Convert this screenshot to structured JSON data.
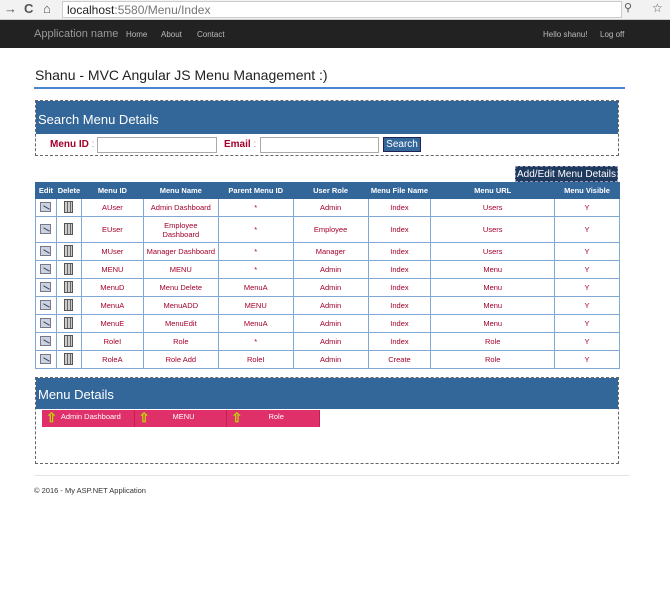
{
  "browser": {
    "url_host": "localhost",
    "url_path": ":5580/Menu/Index"
  },
  "navbar": {
    "brand": "Application name",
    "links": [
      "Home",
      "About",
      "Contact"
    ],
    "greeting": "Hello shanu!",
    "logoff": "Log off"
  },
  "page_title": "Shanu - MVC Angular JS Menu Management :)",
  "search": {
    "title": "Search Menu Details",
    "menu_id_label": "Menu ID",
    "email_label": "Email",
    "colon": ":",
    "menu_id_value": "",
    "email_value": "",
    "button": "Search"
  },
  "add_edit_button": "Add/Edit Menu Details",
  "table": {
    "headers": [
      "Edit",
      "Delete",
      "Menu ID",
      "Menu Name",
      "Parent Menu ID",
      "User Role",
      "Menu File Name",
      "Menu URL",
      "Menu Visible"
    ],
    "rows": [
      [
        "AUser",
        "Admin Dashboard",
        "*",
        "Admin",
        "Index",
        "Users",
        "Y"
      ],
      [
        "EUser",
        "Employee Dashboard",
        "*",
        "Employee",
        "Index",
        "Users",
        "Y"
      ],
      [
        "MUser",
        "Manager Dashboard",
        "*",
        "Manager",
        "Index",
        "Users",
        "Y"
      ],
      [
        "MENU",
        "MENU",
        "*",
        "Admin",
        "Index",
        "Menu",
        "Y"
      ],
      [
        "MenuD",
        "Menu Delete",
        "MenuA",
        "Admin",
        "Index",
        "Menu",
        "Y"
      ],
      [
        "MenuA",
        "MenuADD",
        "MENU",
        "Admin",
        "Index",
        "Menu",
        "Y"
      ],
      [
        "MenuE",
        "MenuEdit",
        "MenuA",
        "Admin",
        "Index",
        "Menu",
        "Y"
      ],
      [
        "RoleI",
        "Role",
        "*",
        "Admin",
        "Index",
        "Role",
        "Y"
      ],
      [
        "RoleA",
        "Role Add",
        "RoleI",
        "Admin",
        "Create",
        "Role",
        "Y"
      ]
    ]
  },
  "menu_details": {
    "title": "Menu Details",
    "items": [
      "Admin Dashboard",
      "MENU",
      "Role"
    ]
  },
  "footer": "© 2016 - My ASP.NET Application"
}
